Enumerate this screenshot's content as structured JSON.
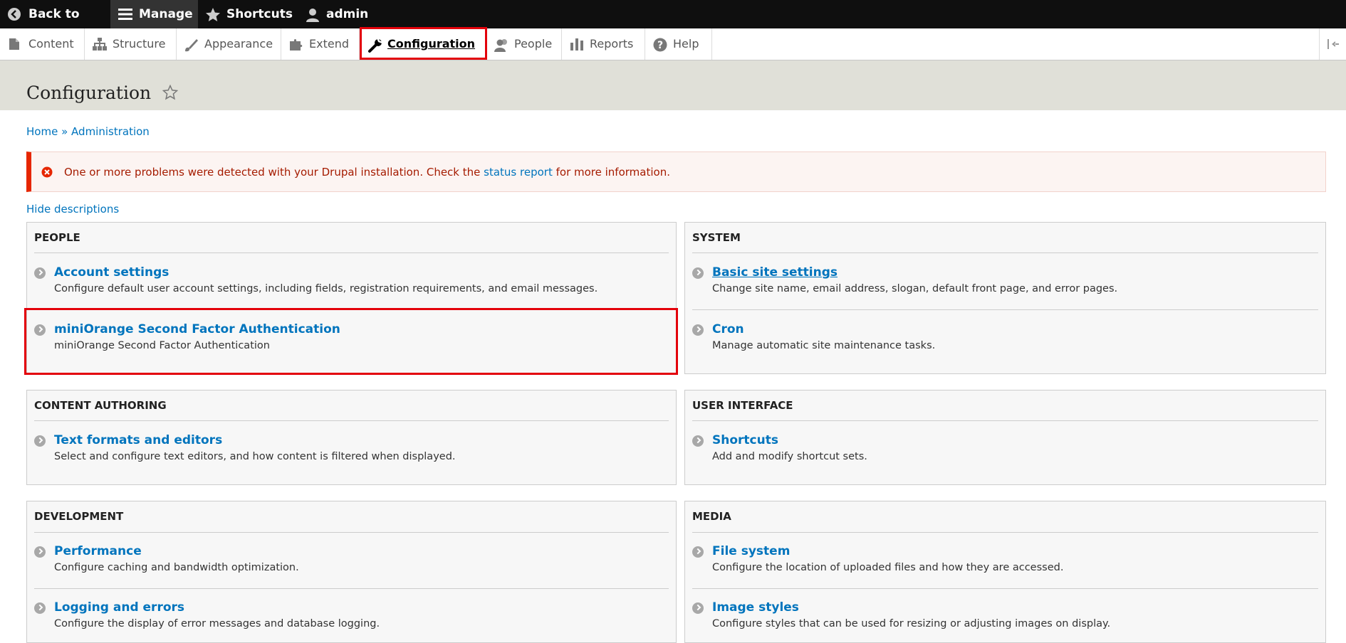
{
  "toolbar": {
    "back": "Back to site",
    "manage": "Manage",
    "shortcuts": "Shortcuts",
    "user": "admin"
  },
  "tray": {
    "content": "Content",
    "structure": "Structure",
    "appearance": "Appearance",
    "extend": "Extend",
    "configuration": "Configuration",
    "people": "People",
    "reports": "Reports",
    "help": "Help"
  },
  "page": {
    "title": "Configuration",
    "breadcrumb_home": "Home",
    "breadcrumb_sep": "»",
    "breadcrumb_admin": "Administration",
    "hide_descriptions": "Hide descriptions"
  },
  "message": {
    "before": "One or more problems were detected with your Drupal installation. Check the ",
    "link": "status report",
    "after": " for more information."
  },
  "panels": {
    "people": {
      "title": "PEOPLE",
      "items": [
        {
          "title": "Account settings",
          "desc": "Configure default user account settings, including fields, registration requirements, and email messages."
        },
        {
          "title": "miniOrange Second Factor Authentication",
          "desc": "miniOrange Second Factor Authentication"
        }
      ]
    },
    "system": {
      "title": "SYSTEM",
      "items": [
        {
          "title": "Basic site settings",
          "desc": "Change site name, email address, slogan, default front page, and error pages."
        },
        {
          "title": "Cron",
          "desc": "Manage automatic site maintenance tasks."
        }
      ]
    },
    "content_authoring": {
      "title": "CONTENT AUTHORING",
      "items": [
        {
          "title": "Text formats and editors",
          "desc": "Select and configure text editors, and how content is filtered when displayed."
        }
      ]
    },
    "user_interface": {
      "title": "USER INTERFACE",
      "items": [
        {
          "title": "Shortcuts",
          "desc": "Add and modify shortcut sets."
        }
      ]
    },
    "development": {
      "title": "DEVELOPMENT",
      "items": [
        {
          "title": "Performance",
          "desc": "Configure caching and bandwidth optimization."
        },
        {
          "title": "Logging and errors",
          "desc": "Configure the display of error messages and database logging."
        }
      ]
    },
    "media": {
      "title": "MEDIA",
      "items": [
        {
          "title": "File system",
          "desc": "Configure the location of uploaded files and how they are accessed."
        },
        {
          "title": "Image styles",
          "desc": "Configure styles that can be used for resizing or adjusting images on display."
        }
      ]
    }
  },
  "colors": {
    "link": "#0074bd",
    "highlight": "#e3000b",
    "error_border": "#e62600"
  }
}
